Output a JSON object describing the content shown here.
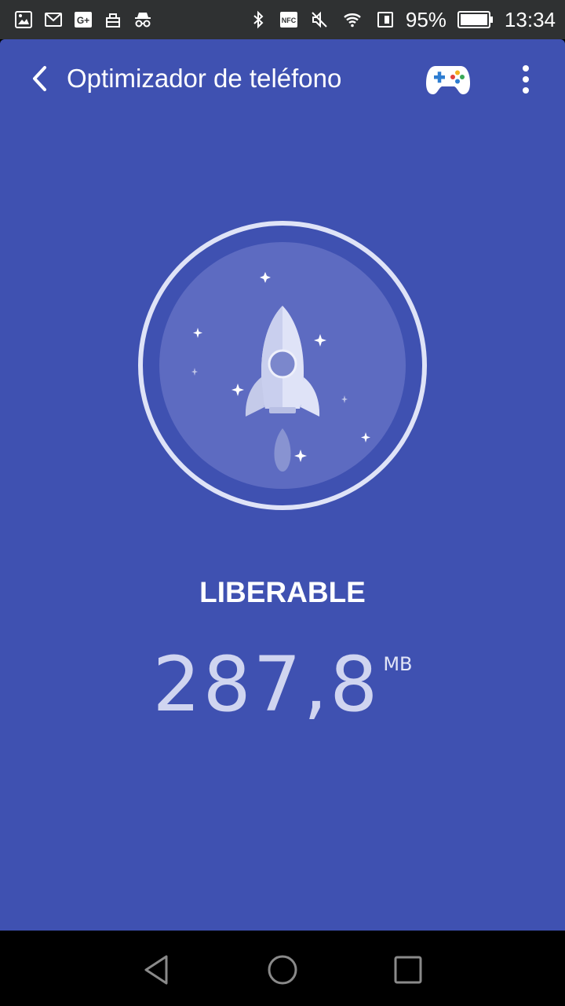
{
  "status_bar": {
    "left_icons": [
      "gallery-icon",
      "mail-icon",
      "google-plus-icon",
      "shopping-icon",
      "incognito-icon"
    ],
    "google_plus_text": "G+",
    "nfc_text": "NFC",
    "battery_percent": "95%",
    "time": "13:34"
  },
  "toolbar": {
    "title": "Optimizador de teléfono"
  },
  "main": {
    "label": "LIBERABLE",
    "value": "287,8",
    "unit": "MB"
  },
  "colors": {
    "app_background": "#3f51b1",
    "status_bar": "#2f3132",
    "circle_ring": "#dfe3f7",
    "circle_fill": "#5c6bc0"
  }
}
